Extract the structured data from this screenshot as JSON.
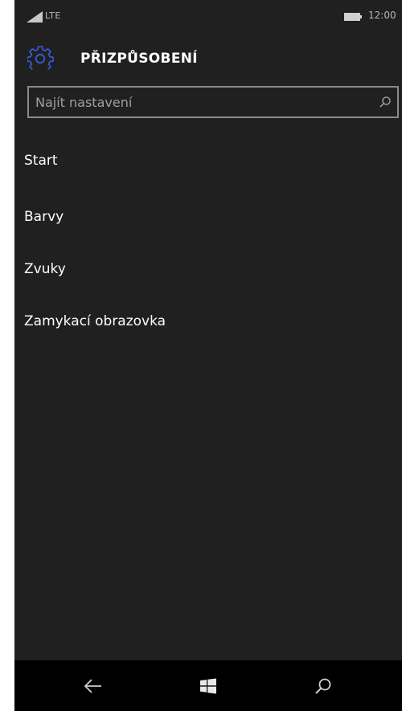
{
  "status_bar": {
    "network": "LTE",
    "time": "12:00"
  },
  "header": {
    "title": "PŘIZPŮSOBENÍ",
    "icon": "gear-icon",
    "accent_color": "#3b5ad8"
  },
  "search": {
    "placeholder": "Najít nastavení",
    "value": ""
  },
  "menu": {
    "items": [
      {
        "label": "Start"
      },
      {
        "label": "Barvy"
      },
      {
        "label": "Zvuky"
      },
      {
        "label": "Zamykací obrazovka"
      }
    ]
  },
  "nav_bar": {
    "back_icon": "back-arrow-icon",
    "home_icon": "windows-logo-icon",
    "search_icon": "search-icon"
  },
  "colors": {
    "background": "#202020",
    "text": "#ffffff",
    "nav_background": "#000000"
  }
}
